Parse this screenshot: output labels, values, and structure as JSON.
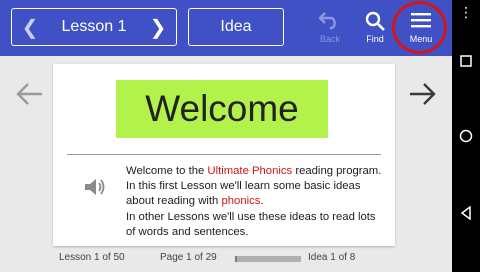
{
  "toolbar": {
    "lesson_label": "Lesson 1",
    "prev_icon": "chevron-left-icon",
    "next_icon": "chevron-right-icon",
    "idea_label": "Idea",
    "back_label": "Back",
    "find_label": "Find",
    "menu_label": "Menu",
    "color": "#3f51c4",
    "menu_highlight_color": "#d41616"
  },
  "content": {
    "title": "Welcome",
    "title_bg": "#b3f24a",
    "text_before": "Welcome to the ",
    "link1": "Ultimate Phonics",
    "text_mid": " reading program. In this first Lesson we'll learn some basic ideas about reading with ",
    "link2": "phonics",
    "text_after": ".",
    "text_line2": "In other Lessons we'll use these ideas to read lots of words and sentences."
  },
  "footer": {
    "lesson": "Lesson 1 of 50",
    "page": "Page 1 of 29",
    "progress": 0.0345,
    "idea": "Idea 1 of 8"
  }
}
